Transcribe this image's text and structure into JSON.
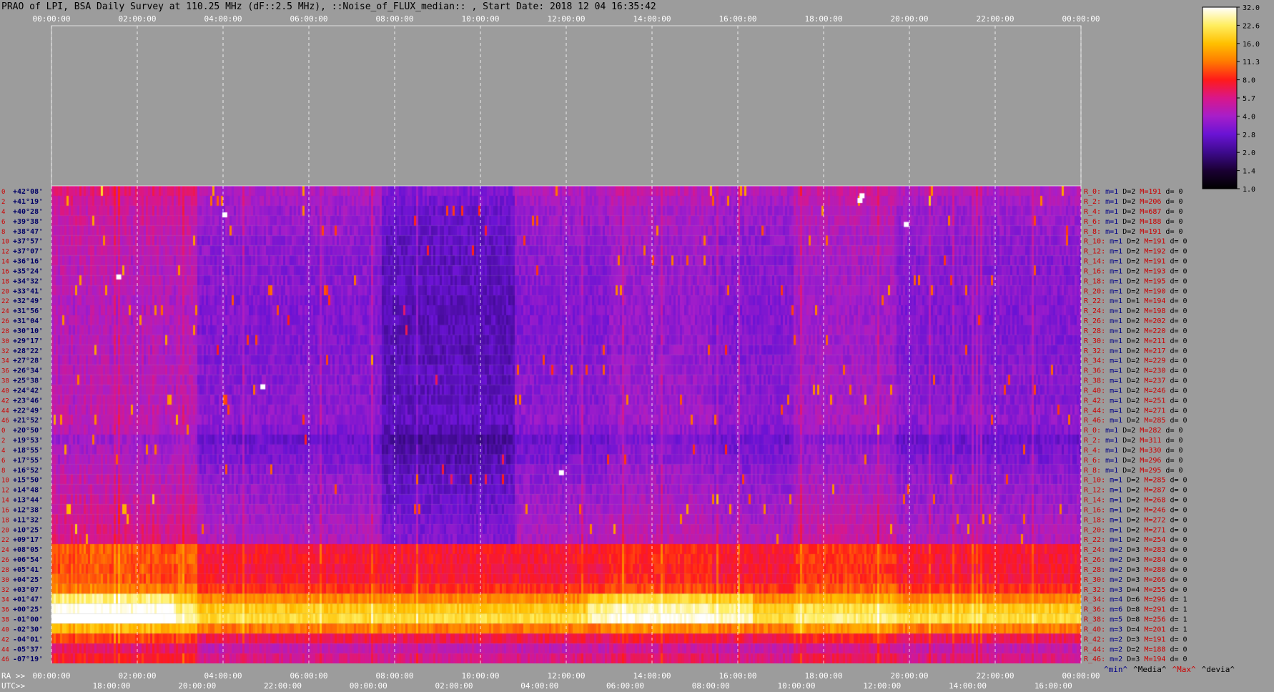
{
  "header": {
    "title": "PRAO of LPI, BSA Daily Survey at 110.25 MHz (dF::2.5 MHz), ::Noise_of_FLUX_median:: , Start Date: 2018 12 04 16:35:42"
  },
  "chart_data": {
    "type": "heatmap",
    "top_time_ticks": [
      "00:00:00",
      "02:00:00",
      "04:00:00",
      "06:00:00",
      "08:00:00",
      "10:00:00",
      "12:00:00",
      "14:00:00",
      "16:00:00",
      "18:00:00",
      "20:00:00",
      "22:00:00",
      "00:00:00"
    ],
    "ra_axis_prefix": "RA >>",
    "ra_ticks": [
      "00:00:00",
      "02:00:00",
      "04:00:00",
      "06:00:00",
      "08:00:00",
      "10:00:00",
      "12:00:00",
      "14:00:00",
      "16:00:00",
      "18:00:00",
      "20:00:00",
      "22:00:00",
      "00:00:00"
    ],
    "utc_axis_prefix": "UTC>>",
    "utc_ticks": [
      "18:00:00",
      "20:00:00",
      "22:00:00",
      "00:00:00",
      "02:00:00",
      "04:00:00",
      "06:00:00",
      "08:00:00",
      "10:00:00",
      "12:00:00",
      "14:00:00",
      "16:00:00"
    ],
    "row_numbers": [
      "0",
      "2",
      "4",
      "6",
      "8",
      "10",
      "12",
      "14",
      "16",
      "18",
      "20",
      "22",
      "24",
      "26",
      "28",
      "30",
      "32",
      "34",
      "36",
      "38",
      "40",
      "42",
      "44",
      "46",
      "0",
      "2",
      "4",
      "6",
      "8",
      "10",
      "12",
      "14",
      "16",
      "18",
      "20",
      "22",
      "24",
      "26",
      "28",
      "30",
      "32",
      "34",
      "36",
      "38",
      "40",
      "42",
      "44",
      "46"
    ],
    "declinations": [
      "+42°08'",
      "+41°19'",
      "+40°28'",
      "+39°38'",
      "+38°47'",
      "+37°57'",
      "+37°07'",
      "+36°16'",
      "+35°24'",
      "+34°32'",
      "+33°41'",
      "+32°49'",
      "+31°56'",
      "+31°04'",
      "+30°10'",
      "+29°17'",
      "+28°22'",
      "+27°28'",
      "+26°34'",
      "+25°38'",
      "+24°42'",
      "+23°46'",
      "+22°49'",
      "+21°52'",
      "+20°50'",
      "+19°53'",
      "+18°55'",
      "+17°55'",
      "+16°52'",
      "+15°50'",
      "+14°48'",
      "+13°44'",
      "+12°38'",
      "+11°32'",
      "+10°25'",
      "+09°17'",
      "+08°05'",
      "+06°54'",
      "+05°41'",
      "+04°25'",
      "+03°07'",
      "+01°47'",
      "+00°25'",
      "-01°00'",
      "-02°30'",
      "-04°01'",
      "-05°37'",
      "-07°19'"
    ],
    "right_stats": [
      {
        "r": "R_0:",
        "m": "m=1",
        "d": "D=2",
        "mx": "M=191",
        "dv": "d= 0"
      },
      {
        "r": "R_2:",
        "m": "m=1",
        "d": "D=2",
        "mx": "M=206",
        "dv": "d= 0"
      },
      {
        "r": "R_4:",
        "m": "m=1",
        "d": "D=2",
        "mx": "M=687",
        "dv": "d= 0"
      },
      {
        "r": "R_6:",
        "m": "m=1",
        "d": "D=2",
        "mx": "M=188",
        "dv": "d= 0"
      },
      {
        "r": "R_8:",
        "m": "m=1",
        "d": "D=2",
        "mx": "M=191",
        "dv": "d= 0"
      },
      {
        "r": "R_10:",
        "m": "m=1",
        "d": "D=2",
        "mx": "M=191",
        "dv": "d= 0"
      },
      {
        "r": "R_12:",
        "m": "m=1",
        "d": "D=2",
        "mx": "M=192",
        "dv": "d= 0"
      },
      {
        "r": "R_14:",
        "m": "m=1",
        "d": "D=2",
        "mx": "M=191",
        "dv": "d= 0"
      },
      {
        "r": "R_16:",
        "m": "m=1",
        "d": "D=2",
        "mx": "M=193",
        "dv": "d= 0"
      },
      {
        "r": "R_18:",
        "m": "m=1",
        "d": "D=2",
        "mx": "M=195",
        "dv": "d= 0"
      },
      {
        "r": "R_20:",
        "m": "m=1",
        "d": "D=2",
        "mx": "M=190",
        "dv": "d= 0"
      },
      {
        "r": "R_22:",
        "m": "m=1",
        "d": "D=1",
        "mx": "M=194",
        "dv": "d= 0"
      },
      {
        "r": "R_24:",
        "m": "m=1",
        "d": "D=2",
        "mx": "M=198",
        "dv": "d= 0"
      },
      {
        "r": "R_26:",
        "m": "m=1",
        "d": "D=2",
        "mx": "M=202",
        "dv": "d= 0"
      },
      {
        "r": "R_28:",
        "m": "m=1",
        "d": "D=2",
        "mx": "M=220",
        "dv": "d= 0"
      },
      {
        "r": "R_30:",
        "m": "m=1",
        "d": "D=2",
        "mx": "M=211",
        "dv": "d= 0"
      },
      {
        "r": "R_32:",
        "m": "m=1",
        "d": "D=2",
        "mx": "M=217",
        "dv": "d= 0"
      },
      {
        "r": "R_34:",
        "m": "m=1",
        "d": "D=2",
        "mx": "M=229",
        "dv": "d= 0"
      },
      {
        "r": "R_36:",
        "m": "m=1",
        "d": "D=2",
        "mx": "M=230",
        "dv": "d= 0"
      },
      {
        "r": "R_38:",
        "m": "m=1",
        "d": "D=2",
        "mx": "M=237",
        "dv": "d= 0"
      },
      {
        "r": "R_40:",
        "m": "m=1",
        "d": "D=2",
        "mx": "M=246",
        "dv": "d= 0"
      },
      {
        "r": "R_42:",
        "m": "m=1",
        "d": "D=2",
        "mx": "M=251",
        "dv": "d= 0"
      },
      {
        "r": "R_44:",
        "m": "m=1",
        "d": "D=2",
        "mx": "M=271",
        "dv": "d= 0"
      },
      {
        "r": "R_46:",
        "m": "m=1",
        "d": "D=2",
        "mx": "M=285",
        "dv": "d= 0"
      },
      {
        "r": "R_0:",
        "m": "m=1",
        "d": "D=2",
        "mx": "M=282",
        "dv": "d= 0"
      },
      {
        "r": "R_2:",
        "m": "m=1",
        "d": "D=2",
        "mx": "M=311",
        "dv": "d= 0"
      },
      {
        "r": "R_4:",
        "m": "m=1",
        "d": "D=2",
        "mx": "M=330",
        "dv": "d= 0"
      },
      {
        "r": "R_6:",
        "m": "m=1",
        "d": "D=2",
        "mx": "M=296",
        "dv": "d= 0"
      },
      {
        "r": "R_8:",
        "m": "m=1",
        "d": "D=2",
        "mx": "M=295",
        "dv": "d= 0"
      },
      {
        "r": "R_10:",
        "m": "m=1",
        "d": "D=2",
        "mx": "M=285",
        "dv": "d= 0"
      },
      {
        "r": "R_12:",
        "m": "m=1",
        "d": "D=2",
        "mx": "M=287",
        "dv": "d= 0"
      },
      {
        "r": "R_14:",
        "m": "m=1",
        "d": "D=2",
        "mx": "M=268",
        "dv": "d= 0"
      },
      {
        "r": "R_16:",
        "m": "m=1",
        "d": "D=2",
        "mx": "M=246",
        "dv": "d= 0"
      },
      {
        "r": "R_18:",
        "m": "m=1",
        "d": "D=2",
        "mx": "M=272",
        "dv": "d= 0"
      },
      {
        "r": "R_20:",
        "m": "m=1",
        "d": "D=2",
        "mx": "M=271",
        "dv": "d= 0"
      },
      {
        "r": "R_22:",
        "m": "m=1",
        "d": "D=2",
        "mx": "M=254",
        "dv": "d= 0"
      },
      {
        "r": "R_24:",
        "m": "m=2",
        "d": "D=3",
        "mx": "M=283",
        "dv": "d= 0"
      },
      {
        "r": "R_26:",
        "m": "m=2",
        "d": "D=3",
        "mx": "M=284",
        "dv": "d= 0"
      },
      {
        "r": "R_28:",
        "m": "m=2",
        "d": "D=3",
        "mx": "M=280",
        "dv": "d= 0"
      },
      {
        "r": "R_30:",
        "m": "m=2",
        "d": "D=3",
        "mx": "M=266",
        "dv": "d= 0"
      },
      {
        "r": "R_32:",
        "m": "m=3",
        "d": "D=4",
        "mx": "M=255",
        "dv": "d= 0"
      },
      {
        "r": "R_34:",
        "m": "m=4",
        "d": "D=6",
        "mx": "M=296",
        "dv": "d= 1"
      },
      {
        "r": "R_36:",
        "m": "m=6",
        "d": "D=8",
        "mx": "M=291",
        "dv": "d= 1"
      },
      {
        "r": "R_38:",
        "m": "m=5",
        "d": "D=8",
        "mx": "M=256",
        "dv": "d= 1"
      },
      {
        "r": "R_40:",
        "m": "m=3",
        "d": "D=4",
        "mx": "M=201",
        "dv": "d= 1"
      },
      {
        "r": "R_42:",
        "m": "m=2",
        "d": "D=3",
        "mx": "M=191",
        "dv": "d= 0"
      },
      {
        "r": "R_44:",
        "m": "m=2",
        "d": "D=2",
        "mx": "M=188",
        "dv": "d= 0"
      },
      {
        "r": "R_46:",
        "m": "m=2",
        "d": "D=3",
        "mx": "M=194",
        "dv": "d= 0"
      }
    ],
    "stats_legend": [
      "^min^",
      "^Media^",
      "^Max^",
      "^devia^"
    ],
    "colorbar": {
      "ticks": [
        "32.0",
        "22.6",
        "16.0",
        "11.3",
        "8.0",
        "5.7",
        "4.0",
        "2.8",
        "2.0",
        "1.4",
        "1.0"
      ],
      "stops": [
        "#000000",
        "#1a0033",
        "#3d0a8c",
        "#6a13d4",
        "#a71ec9",
        "#d9178a",
        "#ff1a1a",
        "#ff7a00",
        "#ffc000",
        "#ffee60",
        "#ffffff"
      ]
    },
    "colors": {
      "background": "#9c9c9c",
      "row_label": "#cc0000",
      "dec_label": "#000066",
      "stat_red": "#cc0000",
      "stat_blue": "#000088",
      "grid": "#ffffff"
    },
    "band_structure": {
      "rows": 48,
      "baseline_levels": [
        0.42,
        0.4,
        0.38,
        0.38,
        0.37,
        0.36,
        0.36,
        0.35,
        0.35,
        0.35,
        0.35,
        0.34,
        0.34,
        0.34,
        0.34,
        0.34,
        0.34,
        0.34,
        0.35,
        0.35,
        0.35,
        0.35,
        0.36,
        0.36,
        0.34,
        0.3,
        0.32,
        0.33,
        0.35,
        0.36,
        0.37,
        0.38,
        0.39,
        0.4,
        0.41,
        0.42,
        0.58,
        0.58,
        0.57,
        0.58,
        0.62,
        0.72,
        0.82,
        0.86,
        0.7,
        0.55,
        0.45,
        0.5
      ]
    }
  }
}
